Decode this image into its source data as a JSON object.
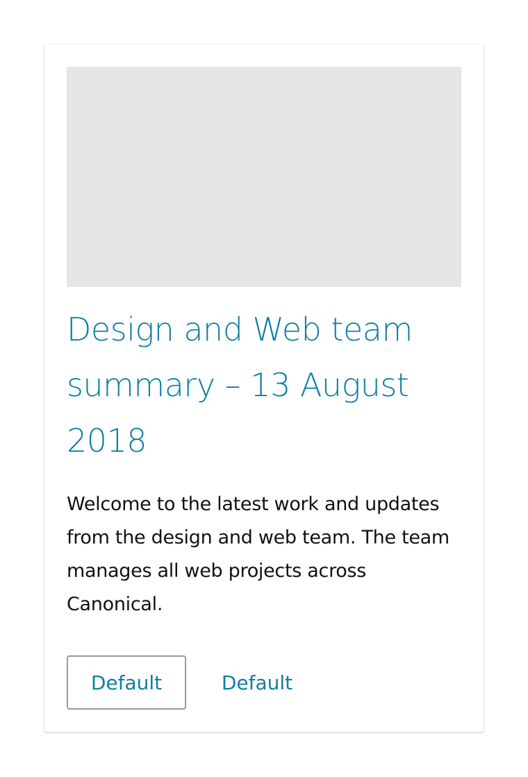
{
  "card": {
    "title": "Design and Web team summary – 13 August 2018",
    "description": "Welcome to the latest work and updates from the design and web team. The team manages all web projects across Canonical.",
    "primary_button_label": "Default",
    "secondary_button_label": "Default"
  },
  "colors": {
    "accent": "#0f7fa3",
    "image_placeholder": "#e5e5e5",
    "button_border": "#999999",
    "body_text": "#111111"
  }
}
